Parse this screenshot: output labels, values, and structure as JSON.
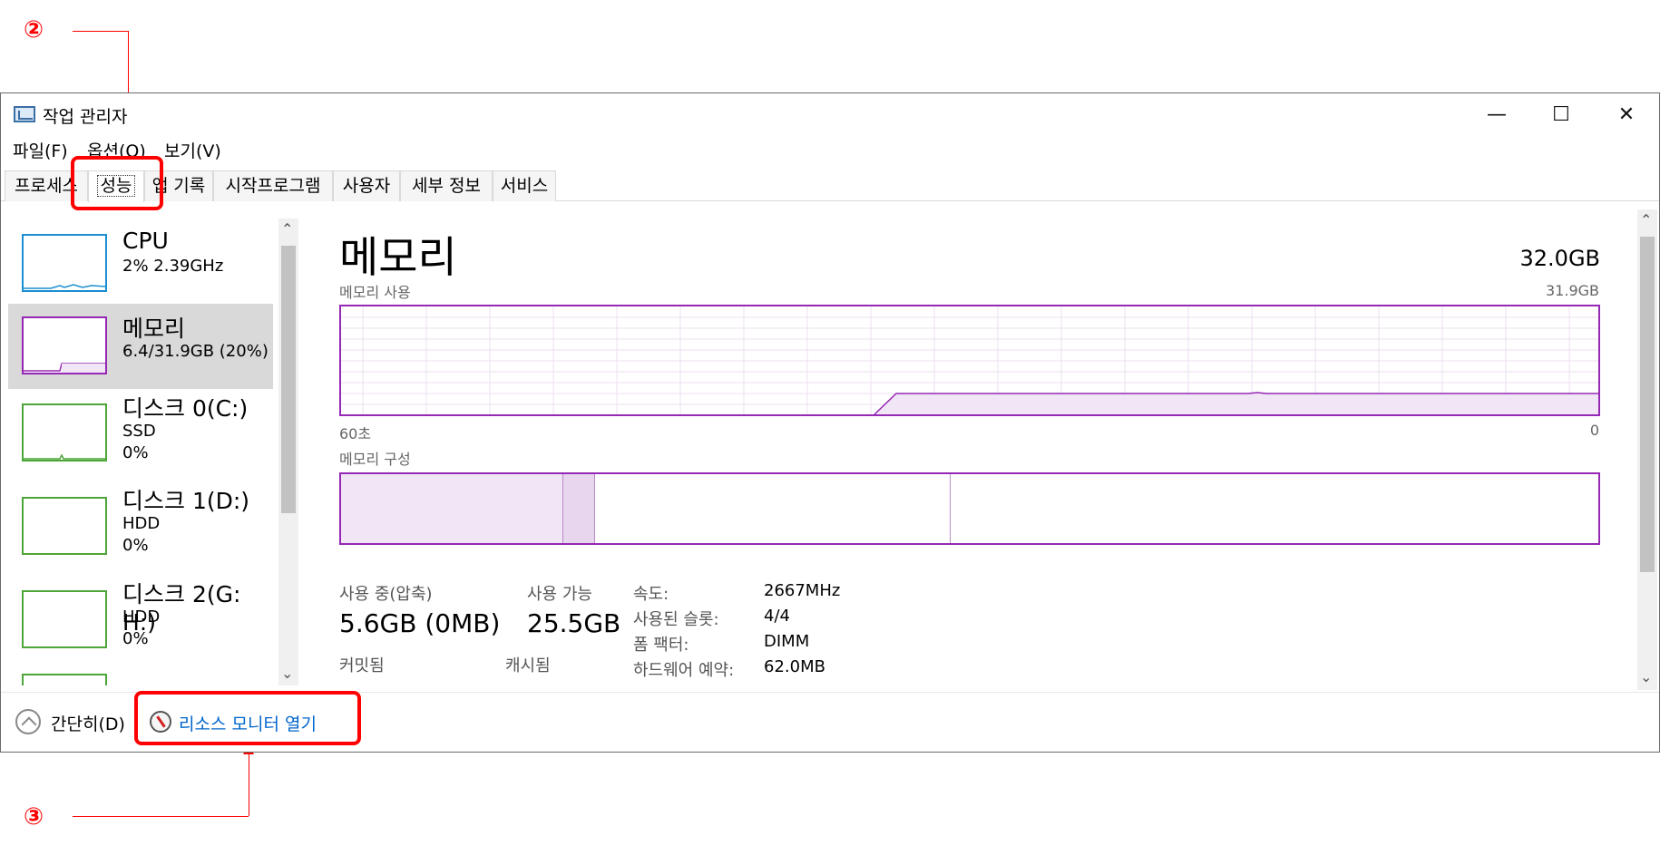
{
  "window": {
    "title": "작업 관리자",
    "controls": {
      "minimize": "—",
      "maximize": "☐",
      "close": "✕"
    }
  },
  "menu": [
    {
      "label": "파일(F)"
    },
    {
      "label": "옵션(O)"
    },
    {
      "label": "보기(V)"
    }
  ],
  "tabs": [
    {
      "label": "프로세스"
    },
    {
      "label": "성능",
      "active": true
    },
    {
      "label": "앱 기록"
    },
    {
      "label": "시작프로그램"
    },
    {
      "label": "사용자"
    },
    {
      "label": "세부 정보"
    },
    {
      "label": "서비스"
    }
  ],
  "sidebar": {
    "items": [
      {
        "name": "CPU",
        "detail": "2% 2.39GHz",
        "color": "#1a8fd1"
      },
      {
        "name": "메모리",
        "detail": "6.4/31.9GB (20%)",
        "color": "#9528b4",
        "selected": true
      },
      {
        "name": "디스크 0(C:)",
        "detail": "SSD",
        "detail2": "0%",
        "color": "#4da639"
      },
      {
        "name": "디스크 1(D:)",
        "detail": "HDD",
        "detail2": "0%",
        "color": "#4da639"
      },
      {
        "name": "디스크 2(G: H:)",
        "detail": "HDD",
        "detail2": "0%",
        "color": "#4da639"
      }
    ]
  },
  "main": {
    "title": "메모리",
    "total": "32.0GB",
    "usage_label": "메모리 사용",
    "usage_max": "31.9GB",
    "axis_left": "60초",
    "axis_right": "0",
    "composition_label": "메모리 구성",
    "stats": {
      "in_use_label": "사용 중(압축)",
      "in_use_value": "5.6GB (0MB)",
      "available_label": "사용 가능",
      "available_value": "25.5GB",
      "committed_label": "커밋됨",
      "cached_label": "캐시됨"
    },
    "info": [
      {
        "label": "속도:",
        "value": "2667MHz"
      },
      {
        "label": "사용된 슬롯:",
        "value": "4/4"
      },
      {
        "label": "폼 팩터:",
        "value": "DIMM"
      },
      {
        "label": "하드웨어 예약:",
        "value": "62.0MB"
      }
    ]
  },
  "footer": {
    "collapse_label": "간단히(D)",
    "resource_monitor_label": "리소스 모니터 열기"
  },
  "annotations": {
    "two": "②",
    "three": "③",
    "color": "#ff0000"
  }
}
